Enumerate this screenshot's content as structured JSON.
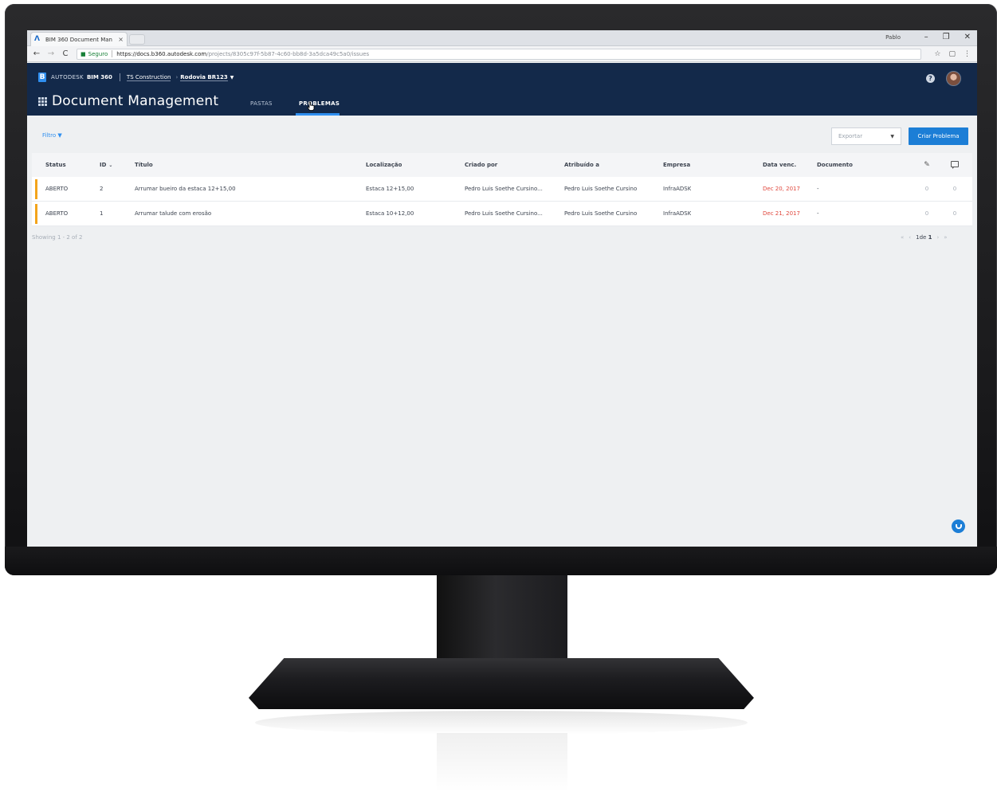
{
  "browser": {
    "tab_title": "BIM 360 Document Man",
    "tab_close": "×",
    "user": "Pablo",
    "window_controls": [
      "–",
      "❐",
      "✕"
    ],
    "secure_label": "Seguro",
    "url_host": "https://docs.b360.autodesk.com",
    "url_path": "/projects/8305c97f-5b87-4c60-bb8d-3a5dca49c5a0/issues"
  },
  "header": {
    "brand_autodesk": "AUTODESK",
    "brand_product": "BIM 360",
    "account": "TS Construction",
    "project": "Rodovia BR123",
    "module_title": "Document Management",
    "tabs": [
      {
        "label": "PASTAS",
        "active": false
      },
      {
        "label": "PROBLEMAS",
        "active": true
      }
    ]
  },
  "toolbar": {
    "filter_label": "Filtro",
    "export_label": "Exportar",
    "create_label": "Criar Problema"
  },
  "table": {
    "columns": {
      "status": "Status",
      "id": "ID",
      "title": "Título",
      "location": "Localização",
      "created_by": "Criado por",
      "assigned_to": "Atribuído a",
      "company": "Empresa",
      "due": "Data venc.",
      "document": "Documento"
    },
    "rows": [
      {
        "status": "ABERTO",
        "id": "2",
        "title": "Arrumar bueiro da estaca 12+15,00",
        "location": "Estaca 12+15,00",
        "created_by": "Pedro Luis Soethe Cursino...",
        "assigned_to": "Pedro Luis Soethe Cursino",
        "company": "InfraADSK",
        "due": "Dec 20, 2017",
        "document": "-",
        "attachments": "0",
        "comments": "0"
      },
      {
        "status": "ABERTO",
        "id": "1",
        "title": "Arrumar talude com erosão",
        "location": "Estaca 10+12,00",
        "created_by": "Pedro Luis Soethe Cursino...",
        "assigned_to": "Pedro Luis Soethe Cursino",
        "company": "InfraADSK",
        "due": "Dec 21, 2017",
        "document": "-",
        "attachments": "0",
        "comments": "0"
      }
    ],
    "showing": "Showing 1 - 2 of 2"
  },
  "pagination": {
    "first": "«",
    "prev": "‹",
    "current": "1",
    "of": "de",
    "total": "1",
    "next": "›",
    "last": "»"
  },
  "colors": {
    "header_bg": "#13294a",
    "accent": "#1c7ed6",
    "status_open": "#f3a41b",
    "overdue": "#e0483e"
  }
}
